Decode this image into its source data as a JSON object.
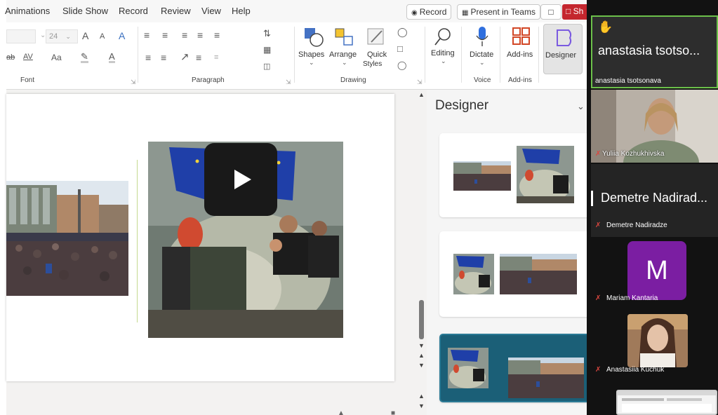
{
  "menu": {
    "items": [
      "Animations",
      "Slide Show",
      "Record",
      "Review",
      "View",
      "Help"
    ],
    "record_button": "Record",
    "present_in_teams_button": "Present in Teams",
    "share_button": "Sh"
  },
  "ribbon": {
    "font_size": "24",
    "font_group_label": "Font",
    "paragraph_group_label": "Paragraph",
    "drawing_group_label": "Drawing",
    "voice_group_label": "Voice",
    "addins_group_label": "Add-ins",
    "shapes_label": "Shapes",
    "arrange_label": "Arrange",
    "quick_styles_label_1": "Quick",
    "quick_styles_label_2": "Styles",
    "editing_label": "Editing",
    "dictate_label": "Dictate",
    "addins_button_label": "Add-ins",
    "designer_button_label": "Designer",
    "font_glyphs": {
      "grow": "A",
      "shrink": "A",
      "clear": "A",
      "spacing": "AV",
      "case": "Aa",
      "color": "A"
    }
  },
  "designer_pane": {
    "title": "Designer"
  },
  "teams": {
    "participants": [
      {
        "display_name": "anastasia tsotso...",
        "name_label": "anastasia tsotsonava",
        "hand_raised": true
      },
      {
        "name_label": "Yuliia Kozhukhivska",
        "muted": true
      },
      {
        "display_name": "Demetre Nadirad...",
        "name_label": "Demetre Nadiradze",
        "muted": true
      },
      {
        "avatar_letter": "M",
        "name_label": "Mariam Kantaria",
        "muted": true
      },
      {
        "name_label": "Anastasiia Kuchuk",
        "muted": true
      }
    ]
  },
  "colors": {
    "accent_red": "#c4262e",
    "designer_selected": "#1b5f77",
    "avatar_purple": "#7b1ea2",
    "active_speaker": "#6cc04a",
    "mic_off": "#d9463f"
  }
}
